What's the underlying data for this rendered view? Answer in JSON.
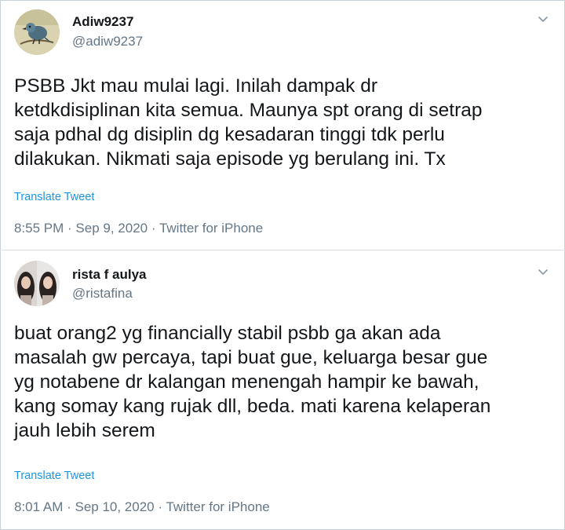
{
  "tweets": [
    {
      "display_name": "Adiw9237",
      "handle": "@adiw9237",
      "text": "PSBB Jkt mau mulai lagi. Inilah dampak dr\nketdkdisiplinan kita semua. Maunya spt orang di setrap\nsaja pdhal dg disiplin dg kesadaran tinggi tdk perlu\ndilakukan. Nikmati saja episode yg berulang ini. Tx",
      "translate_label": "Translate Tweet",
      "time": "8:55 PM",
      "date": "Sep 9, 2020",
      "source": "Twitter for iPhone",
      "separator": " · ",
      "avatar_icon": "bird-avatar-icon",
      "menu_icon": "chevron-down-icon"
    },
    {
      "display_name": "rista f aulya",
      "handle": "@ristafina",
      "text": "buat orang2 yg financially stabil psbb ga akan ada\nmasalah gw percaya, tapi buat gue, keluarga besar gue\nyg notabene dr kalangan menengah hampir ke bawah,\nkang somay kang rujak dll, beda. mati karena kelaperan\njauh lebih serem",
      "translate_label": "Translate Tweet",
      "time": "8:01 AM",
      "date": "Sep 10, 2020",
      "source": "Twitter for iPhone",
      "separator": " · ",
      "avatar_icon": "person-avatar-icon",
      "menu_icon": "chevron-down-icon"
    }
  ],
  "colors": {
    "text": "#14171a",
    "secondary": "#657786",
    "link": "#1b95e0",
    "border": "#d9dfe4"
  }
}
